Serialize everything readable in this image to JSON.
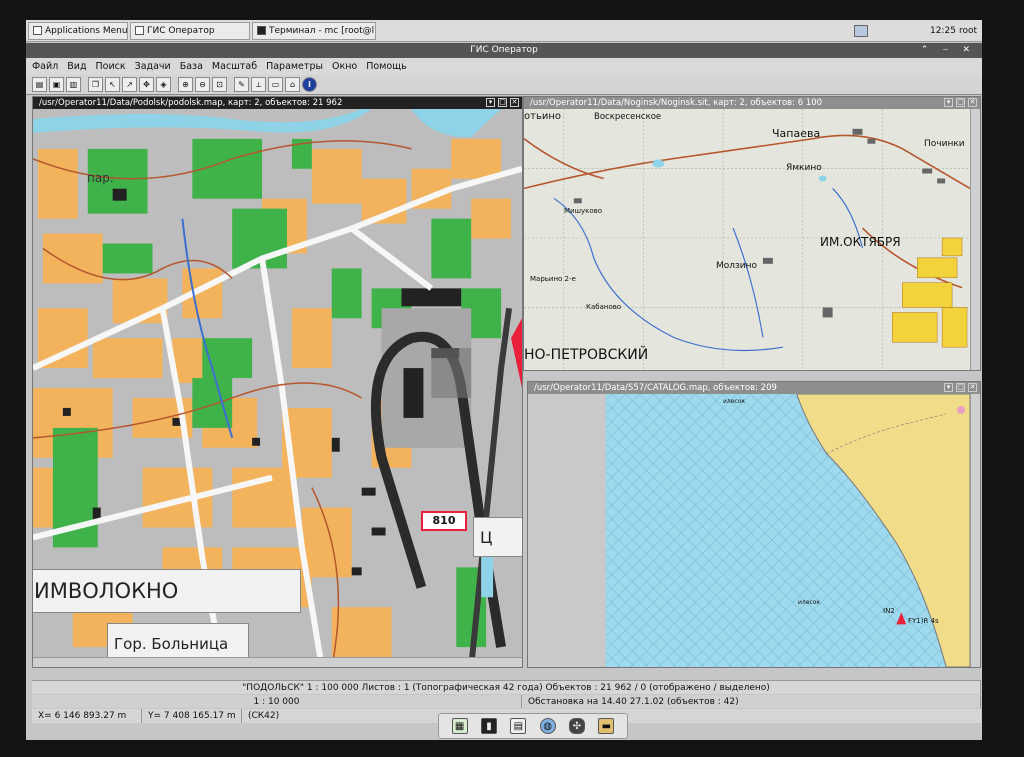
{
  "panel": {
    "apps_menu": "Applications Menu",
    "task_gis": "ГИС Оператор",
    "task_terminal": "Терминал - mc [root@l...",
    "clock": "12:25",
    "user": "root"
  },
  "window": {
    "title": "ГИС Оператор",
    "buttons": "⌃ ⎯ ✕"
  },
  "menu": [
    "Файл",
    "Вид",
    "Поиск",
    "Задачи",
    "База",
    "Масштаб",
    "Параметры",
    "Окно",
    "Помощь"
  ],
  "toolbar_icons": [
    "folder-open-icon",
    "save-icon",
    "print-icon",
    "copy-icon",
    "cursor-icon",
    "select-icon",
    "move-icon",
    "layers-icon",
    "zoom-in-icon",
    "zoom-out-icon",
    "zoom-fit-icon",
    "edit-icon",
    "measure-icon",
    "window-icon",
    "home-icon",
    "info-icon"
  ],
  "windows": {
    "podolsk": {
      "title": "/usr/Operator11/Data/Podolsk/podolsk.map, карт: 2, объектов: 21 962",
      "labels": {
        "park": "пар.",
        "khimvolokno": "ИМВОЛОКНО",
        "hospital": "Гор. Больница",
        "sign": "810",
        "center": "Ц"
      }
    },
    "noginsk": {
      "title": "/usr/Operator11/Data/Noginsk/Noginsk.sit, карт: 2, объектов: 6 100",
      "labels": {
        "chapaeva": "Чапаева",
        "voskresenskoe": "Воскресенское",
        "pochinki": "Починки",
        "yamkino": "Ямкино",
        "im_oktyabrya": "ИМ.ОКТЯБРЯ",
        "molzino": "Молзино",
        "petrovsky": "НО-ПЕТРОВСКИЙ",
        "otyino": "отьино",
        "mishukovo": "Мишуково",
        "kabanovo": "Кабаново",
        "marinino": "Марьино 2-е"
      }
    },
    "s57": {
      "title": "/usr/Operator11/Data/S57/CATALOG.map, объектов: 209",
      "labels": {
        "silt": "илесок",
        "silt2": "илесок",
        "in2": "IN2",
        "fl": "FY1)R 4s"
      }
    }
  },
  "status": {
    "map_name": "\"ПОДОЛЬСК\"  1 : 100 000   Листов : 1   (Топографическая 42 года)  Объектов : 21 962 / 0  (отображено / выделено)",
    "scale": "1 : 10 000",
    "situation": "Обстановка на 14.40  27.1.02   (объектов : 42)",
    "x_coord": "X= 6 146 893.27 m",
    "y_coord": "Y= 7 408 165.17 m",
    "crs": "(СК42)"
  },
  "colors": {
    "block_orange": "#f3b35c",
    "green": "#3fb24a",
    "road_gray": "#bdbdbd",
    "water": "#8fd3e8",
    "sea": "#9ed9ee",
    "land": "#f1dc8a"
  }
}
